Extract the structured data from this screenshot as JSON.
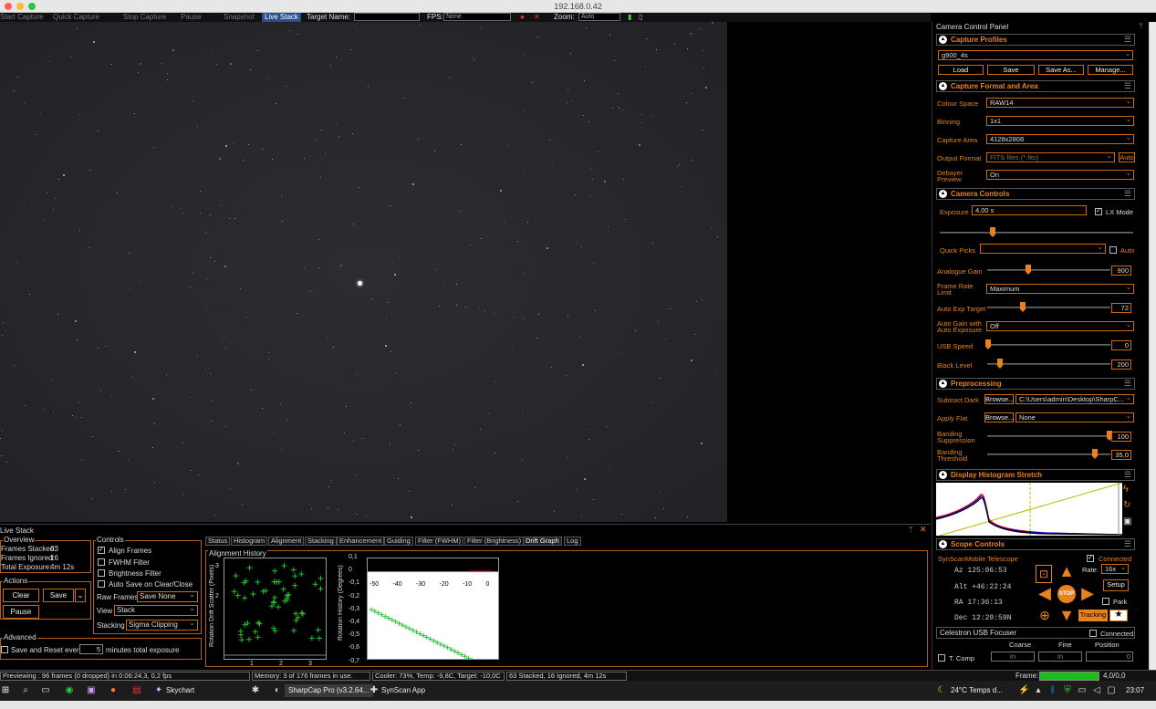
{
  "window": {
    "title": "192.168.0.42"
  },
  "toolbar": {
    "start_capture": "Start Capture",
    "quick_capture": "Quick Capture",
    "stop_capture": "Stop Capture",
    "pause": "Pause",
    "snapshot": "Snapshot",
    "live_stack": "Live Stack",
    "target_name_label": "Target Name:",
    "target_name_value": "",
    "fps_label": "FPS:",
    "fps_value": "None",
    "zoom_label": "Zoom:",
    "zoom_value": "Auto"
  },
  "live_stack": {
    "title": "Live Stack",
    "overview": {
      "label": "Overview",
      "frames_stacked_label": "Frames Stacked:",
      "frames_stacked": "63",
      "frames_ignored_label": "Frames Ignored:",
      "frames_ignored": "16",
      "total_exposure_label": "Total Exposure:",
      "total_exposure": "4m 12s"
    },
    "actions": {
      "label": "Actions",
      "clear": "Clear",
      "save": "Save",
      "pause": "Pause"
    },
    "advanced": {
      "label": "Advanced",
      "save_reset_label": "Save and Reset every",
      "save_reset_value": "5",
      "minutes_label": "minutes total exposure"
    },
    "controls": {
      "label": "Controls",
      "align_frames": "Align Frames",
      "fwhm_filter": "FWHM Filter",
      "brightness_filter": "Brightness Filter",
      "auto_save": "Auto Save on Clear/Close",
      "raw_frames_label": "Raw Frames",
      "raw_frames_value": "Save None",
      "view_label": "View",
      "view_value": "Stack",
      "stacking_label": "Stacking",
      "stacking_value": "Sigma Clipping"
    },
    "tabs": [
      "Status",
      "Histogram",
      "Alignment",
      "Stacking",
      "Enhancement",
      "Guiding",
      "Filter (FWHM)",
      "Filter (Brightness)",
      "Drift Graph",
      "Log"
    ],
    "alignment_history_label": "Alignment History",
    "scatter_ylabel": "Rotation Drift Scatter (Pixels)",
    "rotation_ylabel": "Rotation History (Degrees)",
    "scatter_xticks": [
      "1",
      "2",
      "3"
    ],
    "scatter_yticks": [
      "3",
      "2"
    ],
    "rotation_yticks": [
      "0,1",
      "0",
      "-0,1",
      "-0,2",
      "-0,3",
      "-0,4",
      "-0,5",
      "-0,6",
      "-0,7"
    ],
    "rotation_xticks": [
      "-50",
      "-40",
      "-30",
      "-20",
      "-10",
      "0"
    ]
  },
  "status_bar": {
    "reviewing": "Previewing : 96 frames (0 dropped) in 0:06:24,3, 0,2 fps",
    "memory": "Memory: 3 of 176 frames in use.",
    "cooler": "Cooler: 73%, Temp: -9,8C, Target: -10,0C",
    "stacked": "63 Stacked, 16 Ignored, 4m 12s",
    "frame_label": "Frame:",
    "frame_value": "4,0/0,0"
  },
  "taskbar": {
    "skychart": "Skychart",
    "sharpcap": "SharpCap Pro (v3.2.64...",
    "synscan": "SynScan App",
    "weather": "24°C  Temps d...",
    "time": "23:07"
  },
  "camera_panel": {
    "title": "Camera Control Panel",
    "capture_profiles": {
      "title": "Capture Profiles",
      "profile": "g900_4s",
      "load": "Load",
      "save": "Save",
      "save_as": "Save As...",
      "manage": "Manage..."
    },
    "capture_format": {
      "title": "Capture Format and Area",
      "colour_space_label": "Colour Space",
      "colour_space": "RAW14",
      "binning_label": "Binning",
      "binning": "1x1",
      "capture_area_label": "Capture Area",
      "capture_area": "4128x2808",
      "output_format_label": "Output Format",
      "output_format": "FITS files (*.fits)",
      "auto": "Auto",
      "debayer_label": "Debayer Preview",
      "debayer": "On"
    },
    "camera_controls": {
      "title": "Camera Controls",
      "exposure_label": "Exposure",
      "exposure": "4,00 s",
      "lx_mode": "LX Mode",
      "quick_picks_label": "Quick Picks",
      "quick_picks_auto": "Auto",
      "analogue_gain_label": "Analogue Gain",
      "analogue_gain": "900",
      "frame_rate_label": "Frame Rate Limit",
      "frame_rate": "Maximum",
      "auto_exp_label": "Auto Exp Target",
      "auto_exp": "72",
      "auto_gain_label": "Auto Gain with Auto Exposure",
      "auto_gain": "Off",
      "usb_speed_label": "USB Speed",
      "usb_speed": "0",
      "black_level_label": "Black Level",
      "black_level": "200"
    },
    "preprocessing": {
      "title": "Preprocessing",
      "subtract_dark_label": "Subtract Dark",
      "browse": "Browse...",
      "dark_path": "C:\\Users\\admin\\Desktop\\SharpC...",
      "apply_flat_label": "Apply Flat",
      "flat": "None",
      "banding_supp_label": "Banding Suppression",
      "banding_supp": "100",
      "banding_thresh_label": "Banding Threshold",
      "banding_thresh": "35,0"
    },
    "histogram": {
      "title": "Display Histogram Stretch"
    },
    "scope": {
      "title": "Scope Controls",
      "name": "SynScanMobile Telescope",
      "connected": "Connected",
      "az": "Az  125:06:53",
      "alt": "Alt +46:22:24",
      "ra": "RA  17:36:13",
      "dec": "Dec 12:29:59N",
      "rate_label": "Rate:",
      "rate": "16x",
      "setup": "Setup",
      "park": "Park",
      "tracking": "Tracking",
      "stop": "STOP"
    },
    "focuser": {
      "title": "Celestron USB Focuser",
      "connected": "Connected",
      "coarse": "Coarse",
      "fine": "Fine",
      "position": "Position",
      "tcomp": "T. Comp",
      "in1": "In",
      "in2": "In",
      "pos_value": "0"
    }
  }
}
